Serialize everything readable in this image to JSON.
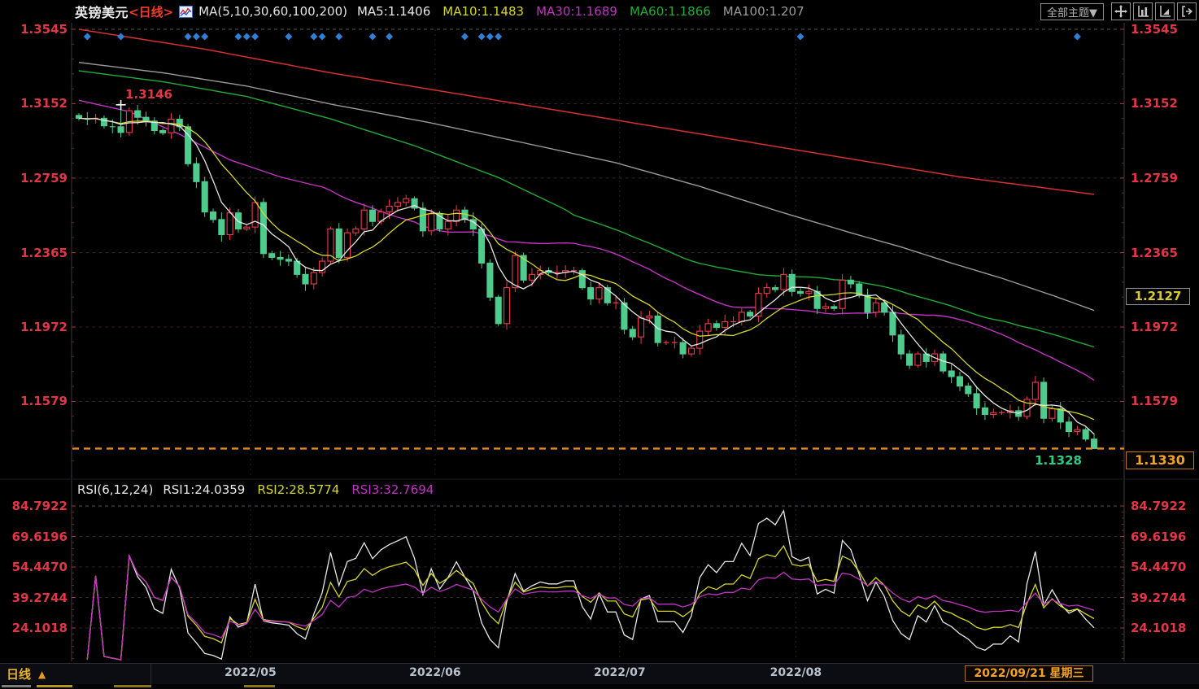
{
  "header": {
    "symbol": "英镑美元",
    "period_tag": "<日线>",
    "ma_group_label": "MA(5,10,30,60,100,200)",
    "ma_values": [
      {
        "label": "MA5:1.1406",
        "color": "#e8e8e8"
      },
      {
        "label": "MA10:1.1483",
        "color": "#d6d62a"
      },
      {
        "label": "MA30:1.1689",
        "color": "#c333c3"
      },
      {
        "label": "MA60:1.1866",
        "color": "#21aa36"
      },
      {
        "label": "MA100:1.207",
        "color": "#9a9a9a"
      }
    ],
    "theme_button": "全部主题▼",
    "toolbar_icons": [
      "crosshair-fit-icon",
      "y-axis-scale-icon",
      "x-axis-scale-icon",
      "exit-chart-icon"
    ]
  },
  "main_chart": {
    "high_label": "1.3146",
    "low_label": "1.1328",
    "mid_price_box": "1.2127",
    "current_price_box": "1.1330"
  },
  "rsi_header": {
    "title": "RSI(6,12,24)",
    "series": [
      {
        "label": "RSI1:24.0359",
        "color": "#e8e8e8"
      },
      {
        "label": "RSI2:28.5774",
        "color": "#d6d62a"
      },
      {
        "label": "RSI3:32.7694",
        "color": "#c333c3"
      }
    ]
  },
  "bottom": {
    "period_label": "日线",
    "period_arrow": "▲",
    "current_date": "2022/09/21 星期三"
  },
  "colors": {
    "up": "#ef3b4c",
    "down": "#4ecb8d",
    "axis_label": "#e23646",
    "ma5": "#e8e8e8",
    "ma10": "#d6d62a",
    "ma30": "#c333c3",
    "ma60": "#21aa36",
    "ma100": "#9a9a9a",
    "ma200": "#d3302e",
    "current_line": "#e8891c",
    "current_text": "#f0a22a",
    "low_label": "#2fc98a",
    "event_marker": "#2f7fd6",
    "date_label": "#b9c2cc"
  },
  "chart_data": {
    "type": "candlestick",
    "title": "英镑美元 日线 (GBP/USD Daily) with MA(5,10,30,60,100,200) and RSI(6,12,24)",
    "legend_position": "top",
    "grid": true,
    "price_axis": {
      "levels": [
        {
          "v": 1.3545,
          "label": "1.3545"
        },
        {
          "v": 1.3152,
          "label": "1.3152"
        },
        {
          "v": 1.2759,
          "label": "1.2759"
        },
        {
          "v": 1.2365,
          "label": "1.2365"
        },
        {
          "v": 1.1972,
          "label": "1.1972"
        },
        {
          "v": 1.1579,
          "label": "1.1579"
        }
      ],
      "ylim": [
        1.125,
        1.3545
      ],
      "current_price": 1.133,
      "mid_marker": 1.2127,
      "marked_high": 1.3146,
      "marked_low": 1.1328
    },
    "candles": {
      "open_first": 1.309,
      "closes": [
        1.3075,
        1.307,
        1.3075,
        1.3035,
        1.303,
        1.3,
        1.3115,
        1.308,
        1.306,
        1.301,
        1.2998,
        1.307,
        1.303,
        1.2835,
        1.274,
        1.258,
        1.254,
        1.246,
        1.2575,
        1.249,
        1.25,
        1.263,
        1.236,
        1.234,
        1.233,
        1.232,
        1.225,
        1.22,
        1.226,
        1.232,
        1.249,
        1.234,
        1.247,
        1.249,
        1.259,
        1.253,
        1.258,
        1.261,
        1.263,
        1.265,
        1.26,
        1.248,
        1.257,
        1.249,
        1.253,
        1.259,
        1.254,
        1.249,
        1.231,
        1.213,
        1.199,
        1.218,
        1.235,
        1.222,
        1.225,
        1.227,
        1.226,
        1.226,
        1.227,
        1.227,
        1.218,
        1.212,
        1.218,
        1.21,
        1.21,
        1.196,
        1.192,
        1.202,
        1.203,
        1.189,
        1.189,
        1.189,
        1.183,
        1.186,
        1.195,
        1.199,
        1.197,
        1.2,
        1.2,
        1.205,
        1.203,
        1.215,
        1.218,
        1.217,
        1.225,
        1.216,
        1.215,
        1.216,
        1.207,
        1.208,
        1.207,
        1.222,
        1.22,
        1.214,
        1.205,
        1.21,
        1.205,
        1.193,
        1.183,
        1.177,
        1.183,
        1.179,
        1.183,
        1.174,
        1.171,
        1.166,
        1.162,
        1.1545,
        1.151,
        1.152,
        1.152,
        1.153,
        1.15,
        1.159,
        1.168,
        1.149,
        1.154,
        1.147,
        1.142,
        1.143,
        1.138,
        1.133
      ],
      "overrides": {
        "5": {
          "high": 1.3146
        },
        "121": {
          "low": 1.1328
        }
      },
      "high_clamp": 1.3146,
      "low_clamp": 1.1328
    },
    "months": [
      {
        "label": "2022/05",
        "index": 19
      },
      {
        "label": "2022/06",
        "index": 41
      },
      {
        "label": "2022/07",
        "index": 63
      },
      {
        "label": "2022/08",
        "index": 84
      }
    ],
    "event_marker_indices": [
      1,
      5,
      13,
      14,
      15,
      19,
      20,
      21,
      25,
      28,
      29,
      31,
      35,
      37,
      46,
      48,
      49,
      50,
      86,
      119
    ],
    "ma_lines": {
      "ma5": {
        "period": 5,
        "color": "#e8e8e8"
      },
      "ma10": {
        "period": 10,
        "color": "#d6d62a"
      },
      "ma30": {
        "period": 30,
        "color": "#c333c3",
        "head_points": [
          [
            0,
            1.317
          ],
          [
            6,
            1.311
          ],
          [
            12,
            1.299
          ],
          [
            18,
            1.2855
          ],
          [
            24,
            1.2765
          ],
          [
            28,
            1.2722
          ]
        ]
      },
      "ma60": {
        "period": 60,
        "color": "#21aa36",
        "head_points": [
          [
            0,
            1.3326
          ],
          [
            10,
            1.3268
          ],
          [
            20,
            1.319
          ],
          [
            30,
            1.3072
          ],
          [
            40,
            1.293
          ],
          [
            50,
            1.2762
          ],
          [
            58,
            1.2592
          ]
        ]
      },
      "ma100": {
        "color": "#9a9a9a",
        "points": [
          [
            0,
            1.337
          ],
          [
            10,
            1.3315
          ],
          [
            20,
            1.3245
          ],
          [
            30,
            1.315
          ],
          [
            42,
            1.305
          ],
          [
            52,
            1.2955
          ],
          [
            64,
            1.284
          ],
          [
            74,
            1.2715
          ],
          [
            84,
            1.2575
          ],
          [
            92,
            1.247
          ],
          [
            98,
            1.2395
          ],
          [
            104,
            1.231
          ],
          [
            110,
            1.223
          ],
          [
            116,
            1.214
          ],
          [
            121,
            1.206
          ]
        ]
      },
      "ma200": {
        "color": "#d3302e",
        "points": [
          [
            0,
            1.3545
          ],
          [
            15,
            1.344
          ],
          [
            30,
            1.3315
          ],
          [
            45,
            1.3205
          ],
          [
            60,
            1.3095
          ],
          [
            75,
            1.2985
          ],
          [
            90,
            1.2875
          ],
          [
            105,
            1.2765
          ],
          [
            121,
            1.2673
          ]
        ]
      }
    },
    "rsi": {
      "periods": [
        6,
        12,
        24
      ],
      "colors": [
        "#e8e8e8",
        "#d6d62a",
        "#c333c3"
      ],
      "last_values": [
        24.0359,
        28.5774,
        32.7694
      ],
      "levels": [
        {
          "v": 84.7922,
          "label": "84.7922"
        },
        {
          "v": 69.6196,
          "label": "69.6196"
        },
        {
          "v": 54.447,
          "label": "54.4470"
        },
        {
          "v": 39.2744,
          "label": "39.2744"
        },
        {
          "v": 24.1018,
          "label": "24.1018"
        }
      ]
    }
  }
}
